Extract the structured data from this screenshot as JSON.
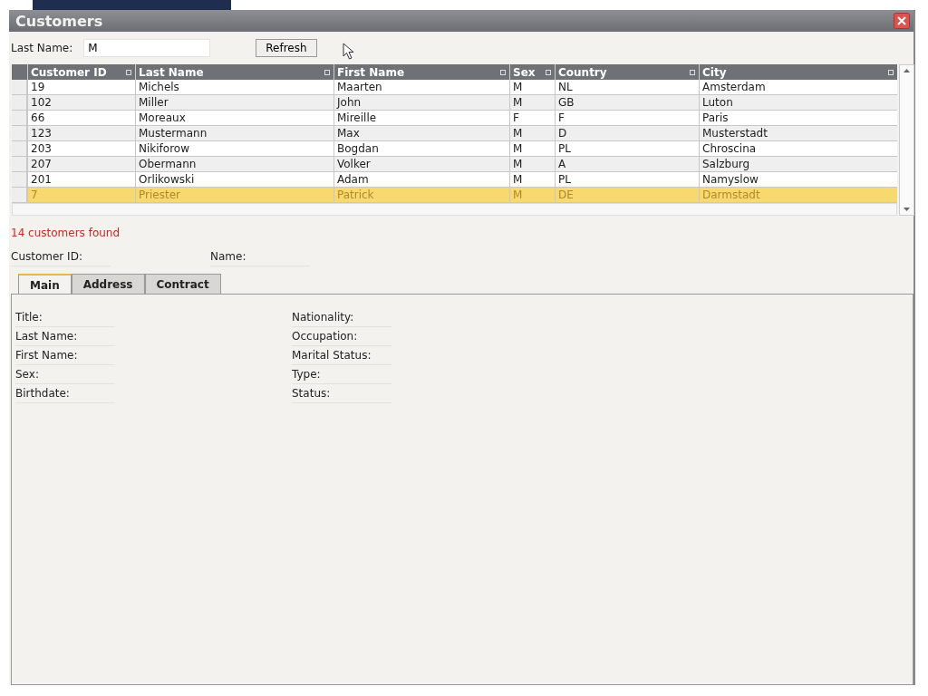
{
  "window": {
    "title": "Customers"
  },
  "filter": {
    "label": "Last Name:",
    "value": "M",
    "button": "Refresh"
  },
  "table": {
    "columns": [
      "Customer ID",
      "Last Name",
      "First Name",
      "Sex",
      "Country",
      "City"
    ],
    "rows": [
      {
        "cells": [
          "19",
          "Michels",
          "Maarten",
          "M",
          "NL",
          "Amsterdam"
        ],
        "selected": false
      },
      {
        "cells": [
          "102",
          "Miller",
          "John",
          "M",
          "GB",
          "Luton"
        ],
        "selected": false
      },
      {
        "cells": [
          "66",
          "Moreaux",
          "Mireille",
          "F",
          "F",
          "Paris"
        ],
        "selected": false
      },
      {
        "cells": [
          "123",
          "Mustermann",
          "Max",
          "M",
          "D",
          "Musterstadt"
        ],
        "selected": false
      },
      {
        "cells": [
          "203",
          "Nikiforow",
          "Bogdan",
          "M",
          "PL",
          "Chroscina"
        ],
        "selected": false
      },
      {
        "cells": [
          "207",
          "Obermann",
          "Volker",
          "M",
          "A",
          "Salzburg"
        ],
        "selected": false
      },
      {
        "cells": [
          "201",
          "Orlikowski",
          "Adam",
          "M",
          "PL",
          "Namyslow"
        ],
        "selected": false
      },
      {
        "cells": [
          "7",
          "Priester",
          "Patrick",
          "M",
          "DE",
          "Darmstadt"
        ],
        "selected": true
      }
    ]
  },
  "status": "14 customers found",
  "header_fields": [
    "Customer ID:",
    "Name:"
  ],
  "tabs": [
    {
      "label": "Main",
      "selected": true
    },
    {
      "label": "Address",
      "selected": false
    },
    {
      "label": "Contract",
      "selected": false
    }
  ],
  "fields_left": [
    "Title:",
    "Last Name:",
    "First Name:",
    "Sex:",
    "Birthdate:"
  ],
  "fields_right": [
    "Nationality:",
    "Occupation:",
    "Marital Status:",
    "Type:",
    "Status:"
  ]
}
